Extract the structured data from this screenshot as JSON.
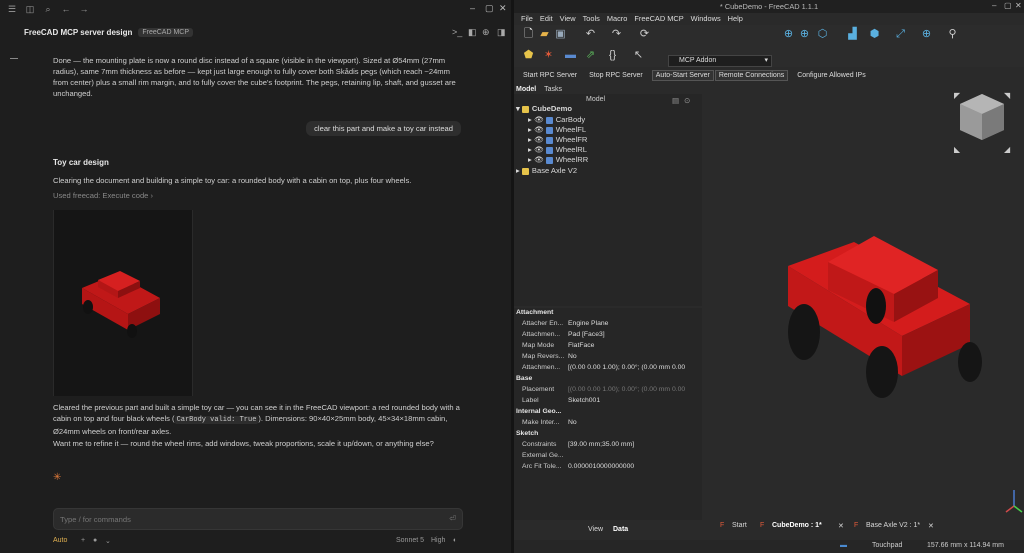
{
  "chat": {
    "title": "FreeCAD MCP server design",
    "chip": "FreeCAD MCP",
    "msg1": "Done — the mounting plate is now a round disc instead of a square (visible in the viewport). Sized at Ø54mm (27mm radius), same 7mm thickness as before — kept just large enough to fully cover both Skådis pegs (which reach ~24mm from center) plus a small rim margin, and to fully cover the cube's footprint. The pegs, retaining lip, shaft, and gusset are unchanged.",
    "user_msg": "clear this part and make a toy car instead",
    "heading": "Toy car design",
    "msg2": "Clearing the document and building a simple toy car: a rounded body with a cabin on top, plus four wheels.",
    "used_tool": "Used freecad: Execute code",
    "msg3_a": "Cleared the previous part and built a simple toy car — you can see it in the FreeCAD viewport: a red rounded body with a cabin on top and four black wheels (",
    "msg3_code": "CarBody valid: True",
    "msg3_b": "). Dimensions: 90×40×25mm body, 45×34×18mm cabin, Ø24mm wheels on front/rear axles.",
    "msg4": "Want me to refine it — round the wheel rims, add windows, tweak proportions, scale it up/down, or anything else?",
    "input_placeholder": "Type / for commands",
    "mode": "Auto",
    "model": "Sonnet 5",
    "effort": "High"
  },
  "freecad": {
    "title": "* CubeDemo - FreeCAD 1.1.1",
    "menu": [
      "File",
      "Edit",
      "View",
      "Tools",
      "Macro",
      "FreeCAD MCP",
      "Windows",
      "Help"
    ],
    "workbench": "MCP Addon",
    "rpc_buttons": [
      "Start RPC Server",
      "Stop RPC Server",
      "Auto-Start Server",
      "Remote Connections",
      "Configure Allowed IPs"
    ],
    "panel_tabs": [
      "Model",
      "Tasks"
    ],
    "tree_header": "Model",
    "tree": [
      {
        "label": "CubeDemo",
        "level": 0
      },
      {
        "label": "CarBody",
        "level": 1
      },
      {
        "label": "WheelFL",
        "level": 1
      },
      {
        "label": "WheelFR",
        "level": 1
      },
      {
        "label": "WheelRL",
        "level": 1
      },
      {
        "label": "WheelRR",
        "level": 1
      },
      {
        "label": "Base Axle V2",
        "level": 0
      }
    ],
    "properties": [
      {
        "group": "Attachment"
      },
      {
        "k": "Attacher En...",
        "v": "Engine Plane"
      },
      {
        "k": "Attachmen...",
        "v": "Pad [Face3]"
      },
      {
        "k": "Map Mode",
        "v": "FlatFace"
      },
      {
        "k": "Map Revers...",
        "v": "No"
      },
      {
        "k": "Attachmen...",
        "v": "[(0.00 0.00 1.00); 0.00°; (0.00 mm  0.00"
      },
      {
        "group": "Base"
      },
      {
        "k": "Placement",
        "v": "[(0.00 0.00 1.00); 0.00°; (0.00 mm  0.00"
      },
      {
        "k": "Label",
        "v": "Sketch001"
      },
      {
        "group": "Internal Geo..."
      },
      {
        "k": "Make Inter...",
        "v": "No"
      },
      {
        "group": "Sketch"
      },
      {
        "k": "Constraints",
        "v": "[39.00 mm;35.00 mm]"
      },
      {
        "k": "External Ge...",
        "v": ""
      },
      {
        "k": "Arc Fit Tole...",
        "v": "0.0000010000000000"
      }
    ],
    "view_tabs": [
      "View",
      "Data"
    ],
    "doc_tabs": [
      "Start",
      "CubeDemo : 1*",
      "Base Axle V2 : 1*"
    ],
    "status": {
      "nav": "Touchpad",
      "dims": "157.66 mm x 114.94 mm"
    },
    "colors": {
      "body": "#d41c1c",
      "wheel": "#1a1a1a",
      "accent": "#e07a3a"
    }
  }
}
